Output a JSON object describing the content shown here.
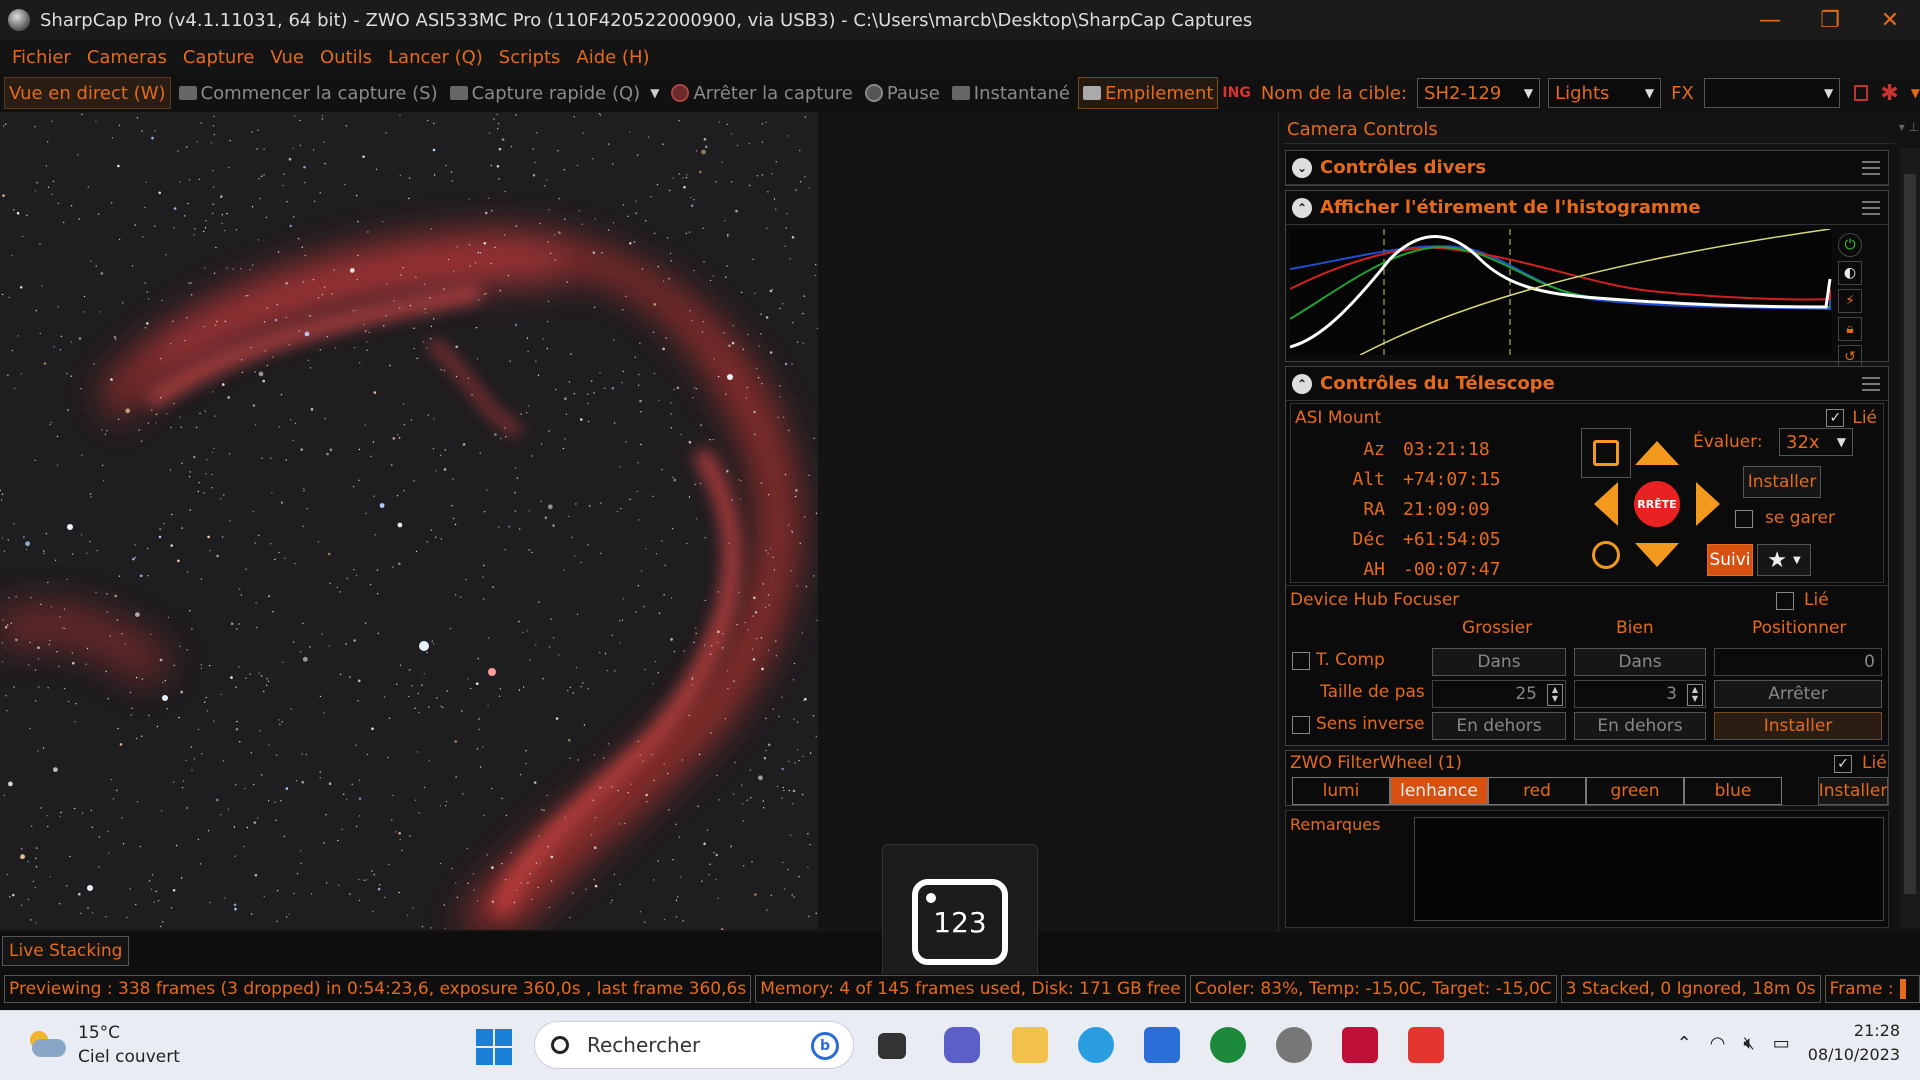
{
  "window": {
    "title": "SharpCap Pro (v4.1.11031, 64 bit) - ZWO ASI533MC Pro (110F420522000900, via USB3) - C:\\Users\\marcb\\Desktop\\SharpCap Captures",
    "minimize": "—",
    "restore": "❐",
    "close": "✕"
  },
  "menu": [
    "Fichier",
    "Cameras",
    "Capture",
    "Vue",
    "Outils",
    "Lancer (Q)",
    "Scripts",
    "Aide (H)"
  ],
  "toolbar": {
    "live_view": "Vue en direct (W)",
    "start_capture": "Commencer la capture (S)",
    "quick_capture": "Capture rapide (Q)",
    "stop_capture": "Arrêter la capture",
    "pause": "Pause",
    "snapshot": "Instantané",
    "stacking": "Empilement",
    "target_label": "Nom de la cible:",
    "target_value": "SH2-129",
    "frame_type": "Lights",
    "fx_label": "FX",
    "fx_value": ""
  },
  "image_area": {
    "live_stacking_tab": "Live Stacking",
    "counter_widget": "123"
  },
  "panel": {
    "header": "Camera Controls",
    "sections": {
      "misc": "Contrôles divers",
      "histogram": "Afficher l'étirement de l'histogramme",
      "telescope": "Contrôles du Télescope"
    }
  },
  "mount": {
    "name": "ASI Mount",
    "linked_label": "Lié",
    "linked": true,
    "coords": [
      {
        "k": "Az",
        "v": "03:21:18"
      },
      {
        "k": "Alt",
        "v": "+74:07:15"
      },
      {
        "k": "RA",
        "v": "21:09:09"
      },
      {
        "k": "Déc",
        "v": "+61:54:05"
      },
      {
        "k": "AH",
        "v": "-00:07:47"
      }
    ],
    "stop_label": "RRÊTE",
    "rate_label": "Évaluer:",
    "rate_value": "32x",
    "install": "Installer",
    "park": "se garer",
    "track": "Suivi"
  },
  "focuser": {
    "name": "Device Hub Focuser",
    "linked_label": "Lié",
    "col_coarse": "Grossier",
    "col_fine": "Bien",
    "col_position": "Positionner",
    "tcomp": "T. Comp",
    "in_label": "Dans",
    "position_value": "0",
    "step_label": "Taille de pas",
    "step_coarse": "25",
    "step_fine": "3",
    "stop": "Arrêter",
    "reverse": "Sens inverse",
    "out_label": "En dehors",
    "install": "Installer"
  },
  "filterwheel": {
    "name": "ZWO FilterWheel (1)",
    "linked_label": "Lié",
    "filters": [
      "lumi",
      "lenhance",
      "red",
      "green",
      "blue"
    ],
    "selected": "lenhance",
    "install": "Installer"
  },
  "remarks_label": "Remarques",
  "status": {
    "preview": "Previewing : 338 frames (3 dropped) in 0:54:23,6, exposure 360,0s , last frame 360,6s",
    "memory": "Memory: 4 of 145 frames used, Disk: 171 GB free",
    "cooler": "Cooler: 83%, Temp: -15,0C, Target: -15,0C",
    "stacked": "3 Stacked, 0 Ignored, 18m 0s",
    "frame_label": "Frame :"
  },
  "taskbar": {
    "temperature": "15°C",
    "weather": "Ciel couvert",
    "search_placeholder": "Rechercher",
    "time": "21:28",
    "date": "08/10/2023"
  },
  "colors": {
    "accent": "#e46a1c",
    "highlight_bg": "#d7500f",
    "dpad_arrow": "#f39a1e",
    "stop_red": "#e82222"
  }
}
